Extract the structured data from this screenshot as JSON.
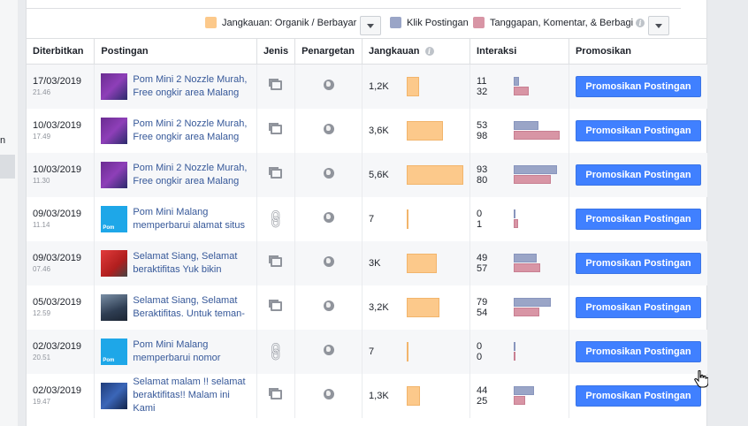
{
  "left_stub": {
    "letter": "n"
  },
  "legend": [
    {
      "label": "Jangkauan: Organik / Berbayar",
      "color": "#fcc98b",
      "has_info": false
    },
    {
      "label": "Klik Postingan",
      "color": "#9aa5c7",
      "has_info": false
    },
    {
      "label": "Tanggapan, Komentar, & Berbagi",
      "color": "#d895a5",
      "has_info": true
    }
  ],
  "columns": {
    "published": "Diterbitkan",
    "post": "Postingan",
    "type": "Jenis",
    "targeting": "Penargetan",
    "reach": "Jangkauan",
    "engagement": "Interaksi",
    "promote": "Promosikan"
  },
  "rows": [
    {
      "date": "17/03/2019",
      "time": "21.46",
      "post_line1": "Pom Mini 2 Nozzle Murah,",
      "post_line2": "Free ongkir area Malang",
      "type_icon": "photo-icon",
      "reach_label": "1,2K",
      "reach_value": 1200,
      "clicks": 11,
      "reactions": 32,
      "button": "Promosikan Postingan",
      "thumb": "purple"
    },
    {
      "date": "10/03/2019",
      "time": "17.49",
      "post_line1": "Pom Mini 2 Nozzle Murah,",
      "post_line2": "Free ongkir area Malang",
      "type_icon": "photo-icon",
      "reach_label": "3,6K",
      "reach_value": 3600,
      "clicks": 53,
      "reactions": 98,
      "button": "Promosikan Postingan",
      "thumb": "purple"
    },
    {
      "date": "10/03/2019",
      "time": "11.30",
      "post_line1": "Pom Mini 2 Nozzle Murah,",
      "post_line2": "Free ongkir area Malang",
      "type_icon": "photo-icon",
      "reach_label": "5,6K",
      "reach_value": 5600,
      "clicks": 93,
      "reactions": 80,
      "button": "Promosikan Postingan",
      "thumb": "purple"
    },
    {
      "date": "09/03/2019",
      "time": "11.14",
      "post_line1": "Pom Mini Malang",
      "post_line2": "memperbarui alamat situs",
      "type_icon": "link-icon",
      "reach_label": "7",
      "reach_value": 7,
      "clicks": 0,
      "reactions": 1,
      "button": "Promosikan Postingan",
      "thumb": "blue",
      "thumb_text": "Pom"
    },
    {
      "date": "09/03/2019",
      "time": "07.46",
      "post_line1": "Selamat Siang, Selamat",
      "post_line2": "beraktifitas Yuk bikin",
      "type_icon": "photo-icon",
      "reach_label": "3K",
      "reach_value": 3000,
      "clicks": 49,
      "reactions": 57,
      "button": "Promosikan Postingan",
      "thumb": "red"
    },
    {
      "date": "05/03/2019",
      "time": "12.59",
      "post_line1": "Selamat Siang, Selamat",
      "post_line2": "Beraktifitas. Untuk teman-",
      "type_icon": "photo-icon",
      "reach_label": "3,2K",
      "reach_value": 3200,
      "clicks": 79,
      "reactions": 54,
      "button": "Promosikan Postingan",
      "thumb": "dark"
    },
    {
      "date": "02/03/2019",
      "time": "20.51",
      "post_line1": "Pom Mini Malang",
      "post_line2": "memperbarui nomor",
      "type_icon": "link-icon",
      "reach_label": "7",
      "reach_value": 7,
      "clicks": 0,
      "reactions": 0,
      "button": "Promosikan Postingan",
      "thumb": "blue",
      "thumb_text": "Pom"
    },
    {
      "date": "02/03/2019",
      "time": "19.47",
      "post_line1": "Selamat malam !! selamat",
      "post_line2": "beraktifitas!! Malam ini Kami",
      "type_icon": "photo-icon",
      "reach_label": "1,3K",
      "reach_value": 1300,
      "clicks": 44,
      "reactions": 25,
      "button": "Promosikan Postingan",
      "thumb": "navy"
    }
  ]
}
